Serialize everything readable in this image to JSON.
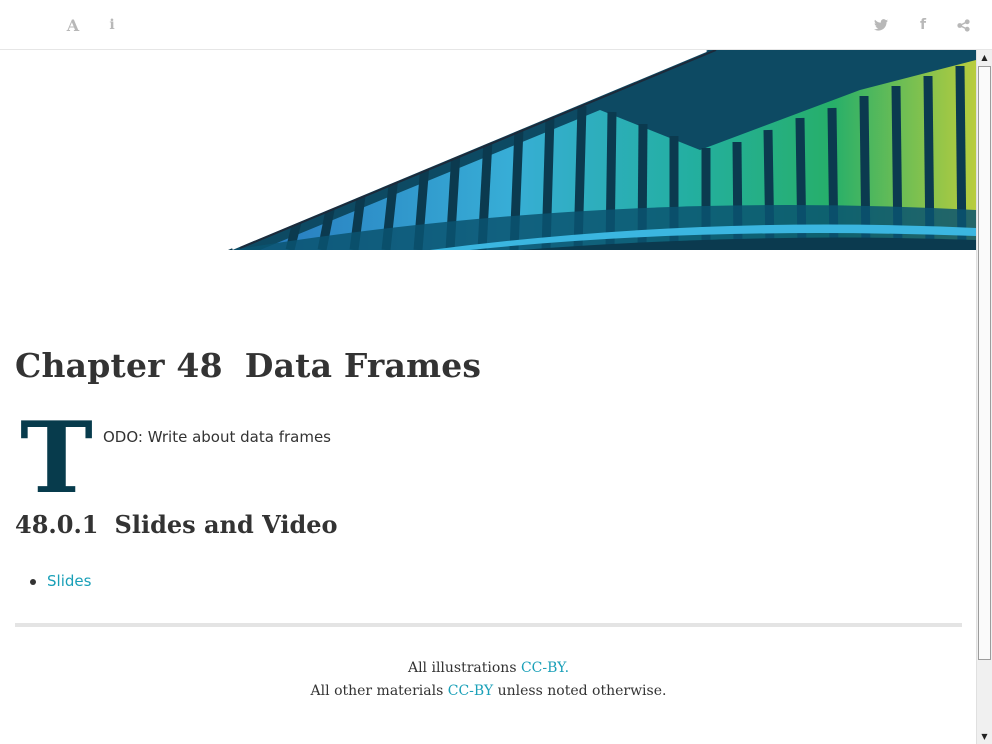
{
  "toolbar": {
    "font_settings_glyph": "A",
    "info_glyph": "i",
    "facebook_glyph": "f",
    "icons": [
      "font-settings-icon",
      "info-icon",
      "twitter-icon",
      "facebook-icon",
      "share-icon"
    ],
    "icon_color": "#b8b8b8"
  },
  "chapter": {
    "number": "Chapter 48",
    "title": "Data Frames"
  },
  "intro": {
    "dropcap": "T",
    "text": "ODO: Write about data frames"
  },
  "section": {
    "number": "48.0.1",
    "title": "Slides and Video"
  },
  "links": [
    {
      "label": "Slides"
    }
  ],
  "footer": {
    "line1_prefix": "All illustrations ",
    "line1_link": "CC-BY.",
    "line2_prefix": "All other materials ",
    "line2_link": "CC-BY",
    "line2_suffix": " unless noted otherwise."
  },
  "colors": {
    "accent_link": "#1aa0b8",
    "dropcap": "#073b4c",
    "banner_dark": "#0b3a4f"
  }
}
